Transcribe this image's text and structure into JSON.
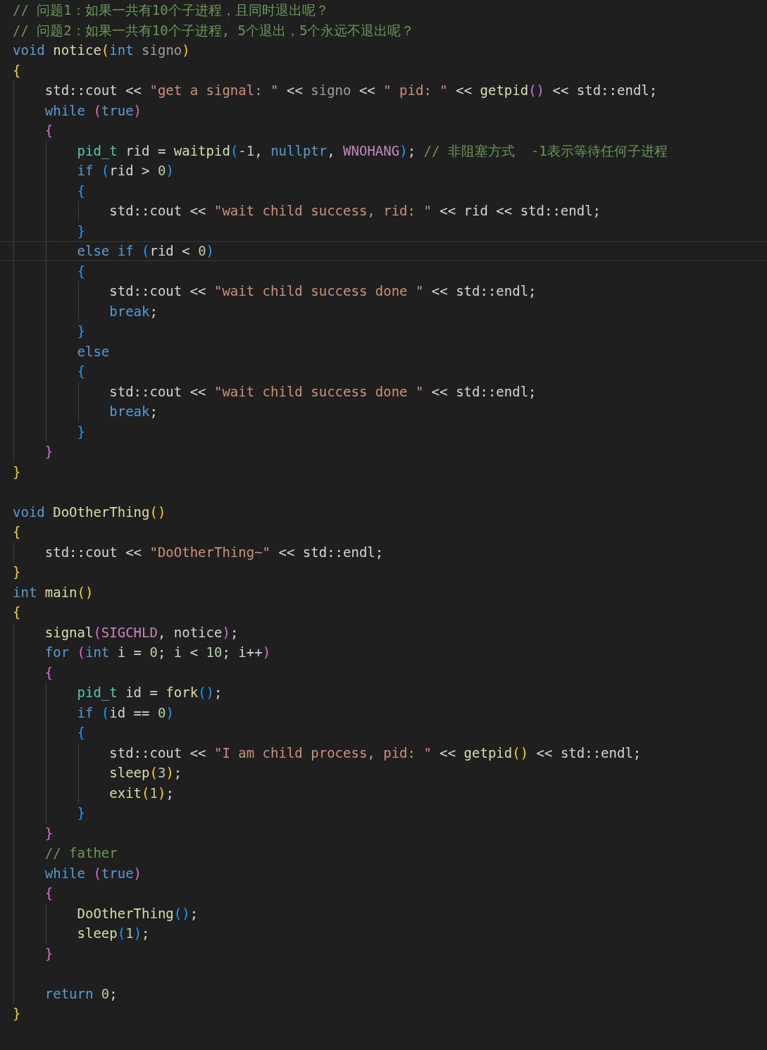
{
  "lines": [
    {
      "current": false,
      "tokens": [
        {
          "kind": "comment",
          "text": "// 问题1：如果一共有10个子进程，且同时退出呢？"
        }
      ]
    },
    {
      "current": false,
      "tokens": [
        {
          "kind": "comment",
          "text": "// 问题2：如果一共有10个子进程, 5个退出，5个永远不退出呢？"
        }
      ]
    },
    {
      "current": false,
      "tokens": [
        {
          "kind": "keyword",
          "text": "void"
        },
        {
          "kind": "function",
          "text": " notice"
        },
        {
          "kind": "bracket1",
          "text": "("
        },
        {
          "kind": "keyword",
          "text": "int"
        },
        {
          "kind": "param",
          "text": " signo"
        },
        {
          "kind": "bracket1",
          "text": ")"
        }
      ]
    },
    {
      "current": false,
      "tokens": [
        {
          "kind": "bracket1",
          "text": "{"
        }
      ]
    },
    {
      "current": false,
      "tokens": [
        {
          "kind": "plain",
          "text": "    std::cout << "
        },
        {
          "kind": "string",
          "text": "\"get a signal: \""
        },
        {
          "kind": "plain",
          "text": " << "
        },
        {
          "kind": "param",
          "text": "signo"
        },
        {
          "kind": "plain",
          "text": " << "
        },
        {
          "kind": "string",
          "text": "\" pid: \""
        },
        {
          "kind": "plain",
          "text": " << "
        },
        {
          "kind": "function",
          "text": "getpid"
        },
        {
          "kind": "bracket2",
          "text": "()"
        },
        {
          "kind": "plain",
          "text": " << std::endl;"
        }
      ]
    },
    {
      "current": false,
      "tokens": [
        {
          "kind": "keyword",
          "text": "    while"
        },
        {
          "kind": "bracket2",
          "text": " ("
        },
        {
          "kind": "keyword",
          "text": "true"
        },
        {
          "kind": "bracket2",
          "text": ")"
        }
      ]
    },
    {
      "current": false,
      "tokens": [
        {
          "kind": "bracket2",
          "text": "    {"
        }
      ]
    },
    {
      "current": false,
      "tokens": [
        {
          "kind": "type",
          "text": "        pid_t"
        },
        {
          "kind": "plain",
          "text": " rid = "
        },
        {
          "kind": "function",
          "text": "waitpid"
        },
        {
          "kind": "bracket3",
          "text": "("
        },
        {
          "kind": "plain",
          "text": "-"
        },
        {
          "kind": "number",
          "text": "1"
        },
        {
          "kind": "plain",
          "text": ", "
        },
        {
          "kind": "keyword",
          "text": "nullptr"
        },
        {
          "kind": "plain",
          "text": ", "
        },
        {
          "kind": "macro",
          "text": "WNOHANG"
        },
        {
          "kind": "bracket3",
          "text": ")"
        },
        {
          "kind": "plain",
          "text": ";"
        },
        {
          "kind": "comment",
          "text": " // 非阻塞方式  -1表示等待任何子进程"
        }
      ]
    },
    {
      "current": false,
      "tokens": [
        {
          "kind": "keyword",
          "text": "        if"
        },
        {
          "kind": "bracket3",
          "text": " ("
        },
        {
          "kind": "plain",
          "text": "rid > "
        },
        {
          "kind": "number",
          "text": "0"
        },
        {
          "kind": "bracket3",
          "text": ")"
        }
      ]
    },
    {
      "current": false,
      "tokens": [
        {
          "kind": "bracket3",
          "text": "        {"
        }
      ]
    },
    {
      "current": false,
      "tokens": [
        {
          "kind": "plain",
          "text": "            std::cout << "
        },
        {
          "kind": "string",
          "text": "\"wait child success, rid: \""
        },
        {
          "kind": "plain",
          "text": " << rid << std::endl;"
        }
      ]
    },
    {
      "current": false,
      "tokens": [
        {
          "kind": "bracket3",
          "text": "        }"
        }
      ]
    },
    {
      "current": true,
      "tokens": [
        {
          "kind": "keyword",
          "text": "        else if"
        },
        {
          "kind": "bracket3",
          "text": " ("
        },
        {
          "kind": "plain",
          "text": "rid < "
        },
        {
          "kind": "number",
          "text": "0"
        },
        {
          "kind": "bracket3",
          "text": ")"
        }
      ]
    },
    {
      "current": false,
      "tokens": [
        {
          "kind": "bracket3",
          "text": "        {"
        }
      ]
    },
    {
      "current": false,
      "tokens": [
        {
          "kind": "plain",
          "text": "            std::cout << "
        },
        {
          "kind": "string",
          "text": "\"wait child success done \""
        },
        {
          "kind": "plain",
          "text": " << std::endl;"
        }
      ]
    },
    {
      "current": false,
      "tokens": [
        {
          "kind": "keyword",
          "text": "            break"
        },
        {
          "kind": "plain",
          "text": ";"
        }
      ]
    },
    {
      "current": false,
      "tokens": [
        {
          "kind": "bracket3",
          "text": "        }"
        }
      ]
    },
    {
      "current": false,
      "tokens": [
        {
          "kind": "keyword",
          "text": "        else"
        }
      ]
    },
    {
      "current": false,
      "tokens": [
        {
          "kind": "bracket3",
          "text": "        {"
        }
      ]
    },
    {
      "current": false,
      "tokens": [
        {
          "kind": "plain",
          "text": "            std::cout << "
        },
        {
          "kind": "string",
          "text": "\"wait child success done \""
        },
        {
          "kind": "plain",
          "text": " << std::endl;"
        }
      ]
    },
    {
      "current": false,
      "tokens": [
        {
          "kind": "keyword",
          "text": "            break"
        },
        {
          "kind": "plain",
          "text": ";"
        }
      ]
    },
    {
      "current": false,
      "tokens": [
        {
          "kind": "bracket3",
          "text": "        }"
        }
      ]
    },
    {
      "current": false,
      "tokens": [
        {
          "kind": "bracket2",
          "text": "    }"
        }
      ]
    },
    {
      "current": false,
      "tokens": [
        {
          "kind": "bracket1",
          "text": "}"
        }
      ]
    },
    {
      "current": false
    },
    {
      "current": false,
      "tokens": [
        {
          "kind": "keyword",
          "text": "void"
        },
        {
          "kind": "function",
          "text": " DoOtherThing"
        },
        {
          "kind": "bracket1",
          "text": "()"
        }
      ]
    },
    {
      "current": false,
      "tokens": [
        {
          "kind": "bracket1",
          "text": "{"
        }
      ]
    },
    {
      "current": false,
      "tokens": [
        {
          "kind": "plain",
          "text": "    std::cout << "
        },
        {
          "kind": "string",
          "text": "\"DoOtherThing~\""
        },
        {
          "kind": "plain",
          "text": " << std::endl;"
        }
      ]
    },
    {
      "current": false,
      "tokens": [
        {
          "kind": "bracket1",
          "text": "}"
        }
      ]
    },
    {
      "current": false,
      "tokens": [
        {
          "kind": "keyword",
          "text": "int"
        },
        {
          "kind": "function",
          "text": " main"
        },
        {
          "kind": "bracket1",
          "text": "()"
        }
      ]
    },
    {
      "current": false,
      "tokens": [
        {
          "kind": "bracket1",
          "text": "{"
        }
      ]
    },
    {
      "current": false,
      "tokens": [
        {
          "kind": "function",
          "text": "    signal"
        },
        {
          "kind": "bracket2",
          "text": "("
        },
        {
          "kind": "macro",
          "text": "SIGCHLD"
        },
        {
          "kind": "plain",
          "text": ", notice"
        },
        {
          "kind": "bracket2",
          "text": ")"
        },
        {
          "kind": "plain",
          "text": ";"
        }
      ]
    },
    {
      "current": false,
      "tokens": [
        {
          "kind": "keyword",
          "text": "    for"
        },
        {
          "kind": "bracket2",
          "text": " ("
        },
        {
          "kind": "keyword",
          "text": "int"
        },
        {
          "kind": "plain",
          "text": " i = "
        },
        {
          "kind": "number",
          "text": "0"
        },
        {
          "kind": "plain",
          "text": "; i < "
        },
        {
          "kind": "number",
          "text": "10"
        },
        {
          "kind": "plain",
          "text": "; i++"
        },
        {
          "kind": "bracket2",
          "text": ")"
        }
      ]
    },
    {
      "current": false,
      "tokens": [
        {
          "kind": "bracket2",
          "text": "    {"
        }
      ]
    },
    {
      "current": false,
      "tokens": [
        {
          "kind": "type",
          "text": "        pid_t"
        },
        {
          "kind": "plain",
          "text": " id = "
        },
        {
          "kind": "function",
          "text": "fork"
        },
        {
          "kind": "bracket3",
          "text": "()"
        },
        {
          "kind": "plain",
          "text": ";"
        }
      ]
    },
    {
      "current": false,
      "tokens": [
        {
          "kind": "keyword",
          "text": "        if"
        },
        {
          "kind": "bracket3",
          "text": " ("
        },
        {
          "kind": "plain",
          "text": "id == "
        },
        {
          "kind": "number",
          "text": "0"
        },
        {
          "kind": "bracket3",
          "text": ")"
        }
      ]
    },
    {
      "current": false,
      "tokens": [
        {
          "kind": "bracket3",
          "text": "        {"
        }
      ]
    },
    {
      "current": false,
      "tokens": [
        {
          "kind": "plain",
          "text": "            std::cout << "
        },
        {
          "kind": "string",
          "text": "\"I am child process, pid: \""
        },
        {
          "kind": "plain",
          "text": " << "
        },
        {
          "kind": "function",
          "text": "getpid"
        },
        {
          "kind": "bracket1",
          "text": "()"
        },
        {
          "kind": "plain",
          "text": " << std::endl;"
        }
      ]
    },
    {
      "current": false,
      "tokens": [
        {
          "kind": "function",
          "text": "            sleep"
        },
        {
          "kind": "bracket1",
          "text": "("
        },
        {
          "kind": "number",
          "text": "3"
        },
        {
          "kind": "bracket1",
          "text": ")"
        },
        {
          "kind": "plain",
          "text": ";"
        }
      ]
    },
    {
      "current": false,
      "tokens": [
        {
          "kind": "function",
          "text": "            exit"
        },
        {
          "kind": "bracket1",
          "text": "("
        },
        {
          "kind": "number",
          "text": "1"
        },
        {
          "kind": "bracket1",
          "text": ")"
        },
        {
          "kind": "plain",
          "text": ";"
        }
      ]
    },
    {
      "current": false,
      "tokens": [
        {
          "kind": "bracket3",
          "text": "        }"
        }
      ]
    },
    {
      "current": false,
      "tokens": [
        {
          "kind": "bracket2",
          "text": "    }"
        }
      ]
    },
    {
      "current": false,
      "tokens": [
        {
          "kind": "comment",
          "text": "    // father"
        }
      ]
    },
    {
      "current": false,
      "tokens": [
        {
          "kind": "keyword",
          "text": "    while"
        },
        {
          "kind": "bracket2",
          "text": " ("
        },
        {
          "kind": "keyword",
          "text": "true"
        },
        {
          "kind": "bracket2",
          "text": ")"
        }
      ]
    },
    {
      "current": false,
      "tokens": [
        {
          "kind": "bracket2",
          "text": "    {"
        }
      ]
    },
    {
      "current": false,
      "tokens": [
        {
          "kind": "function",
          "text": "        DoOtherThing"
        },
        {
          "kind": "bracket3",
          "text": "()"
        },
        {
          "kind": "plain",
          "text": ";"
        }
      ]
    },
    {
      "current": false,
      "tokens": [
        {
          "kind": "function",
          "text": "        sleep"
        },
        {
          "kind": "bracket3",
          "text": "("
        },
        {
          "kind": "number",
          "text": "1"
        },
        {
          "kind": "bracket3",
          "text": ")"
        },
        {
          "kind": "plain",
          "text": ";"
        }
      ]
    },
    {
      "current": false,
      "tokens": [
        {
          "kind": "bracket2",
          "text": "    }"
        }
      ]
    },
    {
      "current": false
    },
    {
      "current": false,
      "tokens": [
        {
          "kind": "keyword",
          "text": "    return"
        },
        {
          "kind": "number",
          "text": " 0"
        },
        {
          "kind": "plain",
          "text": ";"
        }
      ]
    },
    {
      "current": false,
      "tokens": [
        {
          "kind": "bracket1",
          "text": "}"
        }
      ]
    }
  ]
}
